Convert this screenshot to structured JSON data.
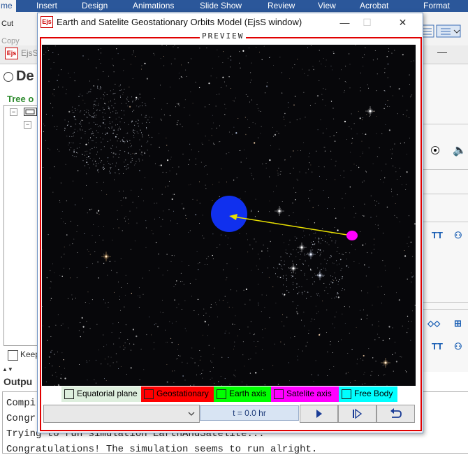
{
  "background_app": {
    "ribbon_tabs": [
      "me",
      "Insert",
      "Design",
      "Animations",
      "Slide Show",
      "Review",
      "View",
      "Acrobat",
      "Format"
    ],
    "ribbon_labels": [
      "Cut",
      "Copy"
    ]
  },
  "ejs_editor": {
    "title": "EjsS",
    "description_label": "De",
    "tree_label": "Tree o",
    "keep_label": "Keep",
    "output_label": "Outpu",
    "output_lines": [
      "Compi",
      "Congr",
      "Trying to run simulation EarthAndSatelite...",
      "Congratulations! The simulation seems to run alright."
    ]
  },
  "window": {
    "logo": "Ejs",
    "title": "Earth and Satelite Geostationary Orbits Model (EjsS window)",
    "controls": {
      "minimize": "—",
      "maximize": "☐",
      "close": "✕"
    },
    "preview_label": "PREVIEW"
  },
  "legend": [
    {
      "label": "Equatorial plane",
      "bg": "#ddeedd",
      "checked": false
    },
    {
      "label": "Geostationary",
      "bg": "#ff0000",
      "checked": false
    },
    {
      "label": "Earth axis",
      "bg": "#00ff00",
      "checked": false
    },
    {
      "label": "Satelite axis",
      "bg": "#ff00ff",
      "checked": false
    },
    {
      "label": "Free Body",
      "bg": "#00ffff",
      "checked": false
    }
  ],
  "controls": {
    "time_display": "t = 0.0 hr",
    "combo_value": "",
    "play": "play-icon",
    "step": "step-forward-icon",
    "reset": "reset-icon"
  },
  "scene": {
    "earth_color": "#1030ee",
    "satellite_color": "#ff00ff",
    "vector_color": "#e8e000"
  }
}
